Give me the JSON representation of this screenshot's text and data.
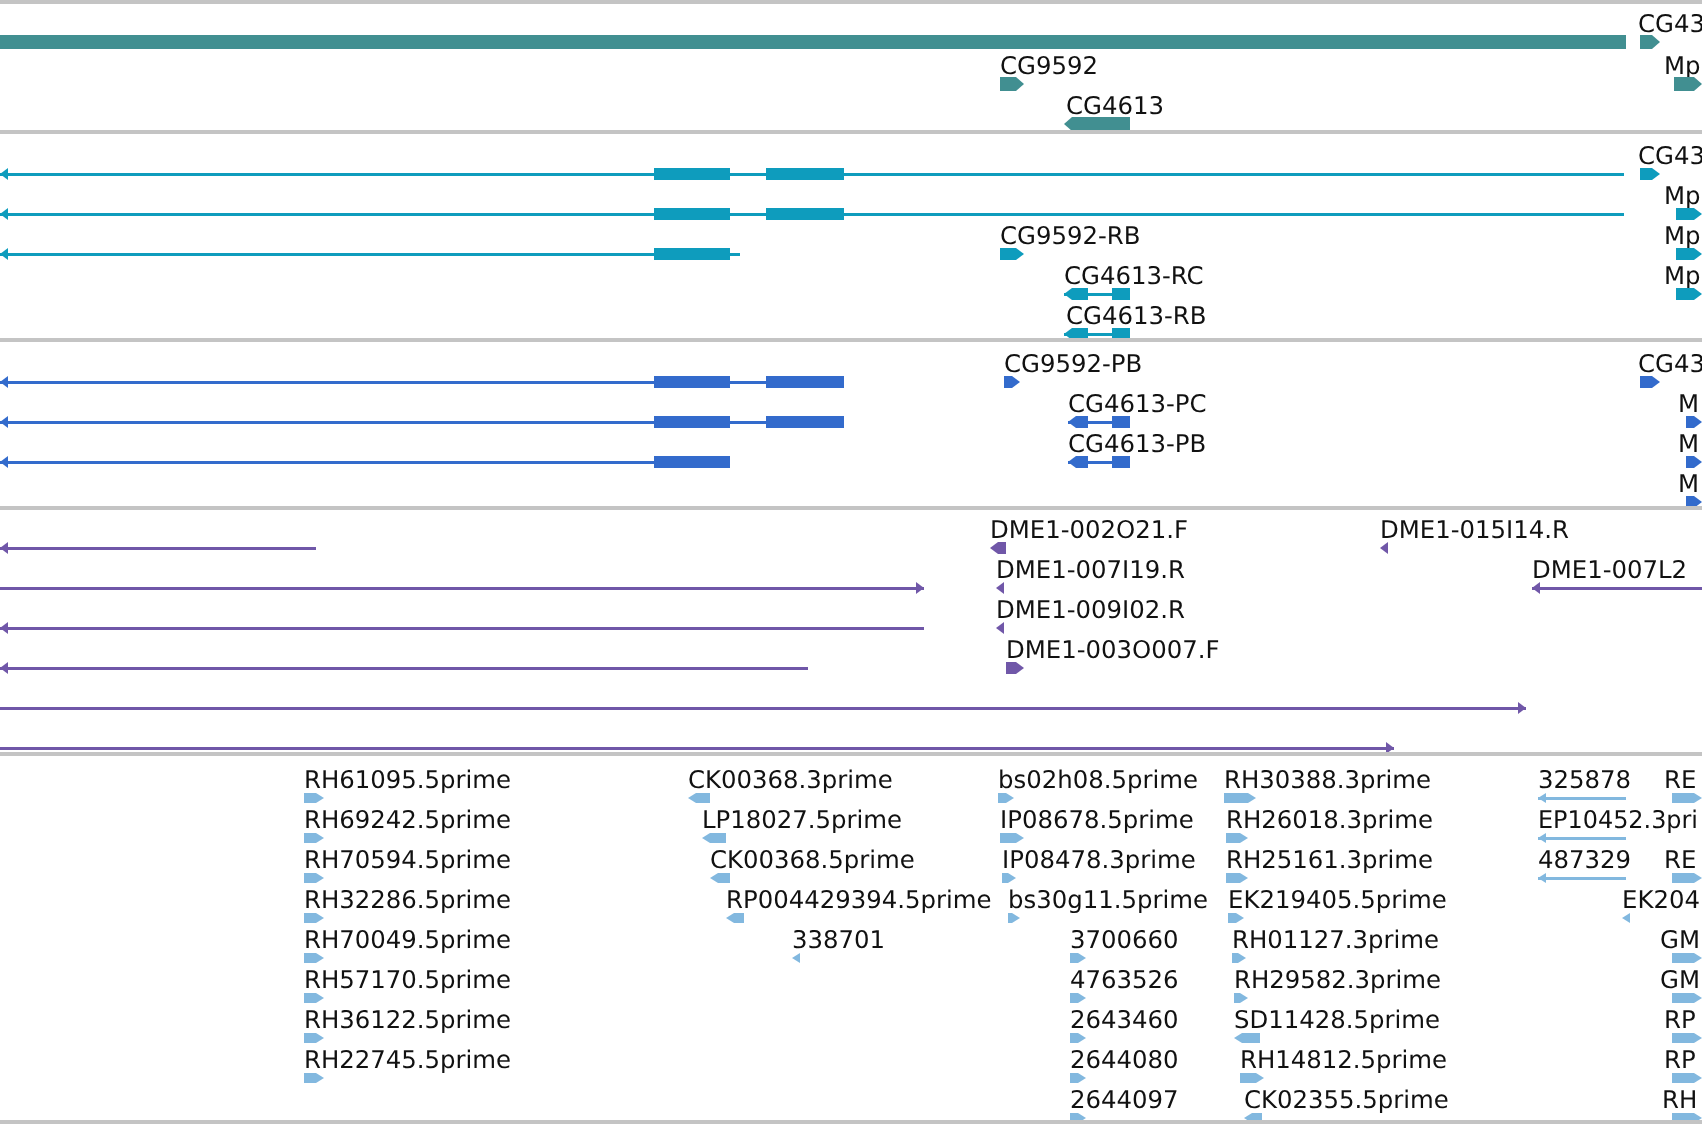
{
  "tracks": [
    {
      "color": "#418f91",
      "features": [
        {
          "arrow": false
        },
        {
          "label": "CG43",
          "reverse": false
        },
        {
          "label": "CG9592",
          "reverse": false
        },
        {
          "label": "Mp",
          "reverse": false
        },
        {
          "label": "CG4613",
          "reverse": true
        }
      ]
    },
    {
      "color": "#0e9cbd",
      "features": [
        {
          "reverse": true
        },
        {
          "label": "CG43",
          "reverse": false
        },
        {
          "reverse": true
        },
        {
          "label": "Mp",
          "reverse": false
        },
        {
          "reverse": true
        },
        {
          "label": "CG9592-RB",
          "reverse": false
        },
        {
          "label": "Mp",
          "reverse": false
        },
        {
          "label": "CG4613-RC",
          "reverse": true
        },
        {
          "label": "Mp",
          "reverse": false
        },
        {
          "label": "CG4613-RB",
          "reverse": true
        }
      ]
    },
    {
      "color": "#336bcc",
      "features": [
        {
          "reverse": true
        },
        {
          "label": "CG9592-PB",
          "reverse": false
        },
        {
          "label": "CG43",
          "reverse": false
        },
        {
          "reverse": true
        },
        {
          "label": "CG4613-PC",
          "reverse": true
        },
        {
          "label": "M",
          "reverse": false
        },
        {
          "reverse": true
        },
        {
          "label": "CG4613-PB",
          "reverse": true
        },
        {
          "label": "M",
          "reverse": false
        },
        {
          "label": "M",
          "reverse": false
        }
      ]
    },
    {
      "color": "#7057a8",
      "features": [
        {
          "reverse": true
        },
        {
          "label": "DME1-002O21.F",
          "reverse": true
        },
        {
          "label": "DME1-015I14.R",
          "reverse": true
        },
        {
          "reverse": false
        },
        {
          "label": "DME1-007I19.R",
          "reverse": true
        },
        {
          "label": "DME1-007L2",
          "reverse": true
        },
        {
          "reverse": true
        },
        {
          "label": "DME1-009I02.R",
          "reverse": true
        },
        {
          "reverse": true
        },
        {
          "label": "DME1-003O007.F",
          "reverse": false
        },
        {
          "reverse": false
        },
        {
          "reverse": false
        }
      ]
    },
    {
      "color": "#82b8df",
      "features": [
        {
          "label": "RH61095.5prime",
          "reverse": false
        },
        {
          "label": "CK00368.3prime",
          "reverse": true
        },
        {
          "label": "bs02h08.5prime",
          "reverse": false
        },
        {
          "label": "RH30388.3prime",
          "reverse": false
        },
        {
          "label": "325878",
          "reverse": true
        },
        {
          "label": "RE",
          "reverse": false
        },
        {
          "label": "RH69242.5prime",
          "reverse": false
        },
        {
          "label": "LP18027.5prime",
          "reverse": true
        },
        {
          "label": "IP08678.5prime",
          "reverse": false
        },
        {
          "label": "RH26018.3prime",
          "reverse": false
        },
        {
          "label": "EP10452.3pri",
          "reverse": true
        },
        {
          "label": "RH70594.5prime",
          "reverse": false
        },
        {
          "label": "CK00368.5prime",
          "reverse": true
        },
        {
          "label": "IP08478.3prime",
          "reverse": false
        },
        {
          "label": "RH25161.3prime",
          "reverse": false
        },
        {
          "label": "487329",
          "reverse": true
        },
        {
          "label": "RE",
          "reverse": false
        },
        {
          "label": "RH32286.5prime",
          "reverse": false
        },
        {
          "label": "RP004429394.5prime",
          "reverse": true
        },
        {
          "label": "bs30g11.5prime",
          "reverse": false
        },
        {
          "label": "EK219405.5prime",
          "reverse": false
        },
        {
          "label": "EK204",
          "reverse": true
        },
        {
          "label": "RH70049.5prime",
          "reverse": false
        },
        {
          "label": "338701",
          "reverse": true
        },
        {
          "label": "3700660",
          "reverse": false
        },
        {
          "label": "RH01127.3prime",
          "reverse": false
        },
        {
          "label": "GM",
          "reverse": false
        },
        {
          "label": "RH57170.5prime",
          "reverse": false
        },
        {
          "label": "4763526",
          "reverse": false
        },
        {
          "label": "RH29582.3prime",
          "reverse": false
        },
        {
          "label": "GM",
          "reverse": false
        },
        {
          "label": "RH36122.5prime",
          "reverse": false
        },
        {
          "label": "2643460",
          "reverse": false
        },
        {
          "label": "SD11428.5prime",
          "reverse": true
        },
        {
          "label": "RP",
          "reverse": false
        },
        {
          "label": "RH22745.5prime",
          "reverse": false
        },
        {
          "label": "2644080",
          "reverse": false
        },
        {
          "label": "RH14812.5prime",
          "reverse": false
        },
        {
          "label": "RP",
          "reverse": false
        },
        {
          "label": "2644097",
          "reverse": false
        },
        {
          "label": "CK02355.5prime",
          "reverse": true
        },
        {
          "label": "RH",
          "reverse": false
        }
      ]
    }
  ]
}
